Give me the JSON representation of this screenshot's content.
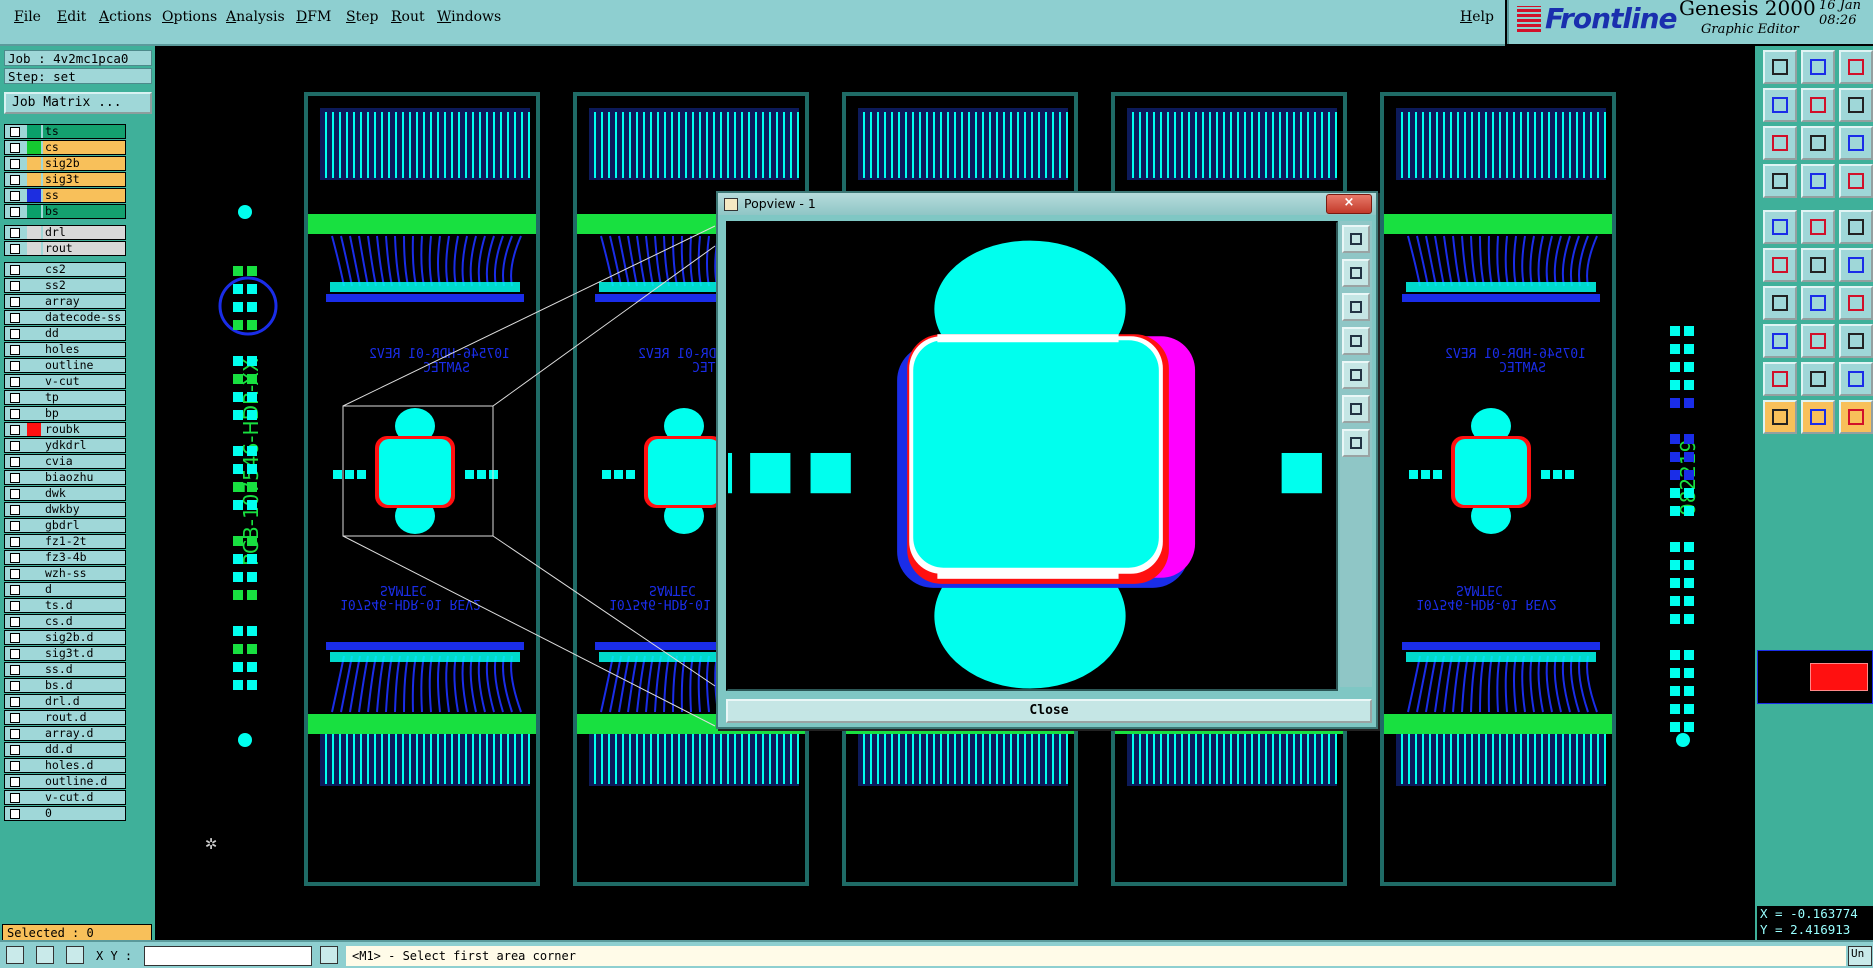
{
  "menu": {
    "items": [
      "File",
      "Edit",
      "Actions",
      "Options",
      "Analysis",
      "DFM",
      "Step",
      "Rout",
      "Windows"
    ],
    "help": "Help"
  },
  "brand": {
    "logo_text": "Frontline",
    "product": "Genesis 2000",
    "subtitle": "Graphic Editor",
    "date_line1": "16 Jan",
    "date_line2": "08:26"
  },
  "job": {
    "job_label": "Job : 4v2mc1pca0",
    "step_label": "Step: set",
    "matrix_button": "Job Matrix ..."
  },
  "layers": {
    "group1": [
      {
        "name": "ts",
        "swatch": "#0aa06a",
        "bg": "#14a16f"
      },
      {
        "name": "cs",
        "swatch": "#15c930",
        "bg": "#f8c05a"
      },
      {
        "name": "sig2b",
        "swatch": "#f8c05a",
        "bg": "#f8c05a"
      },
      {
        "name": "sig3t",
        "swatch": "#f8c05a",
        "bg": "#f8c05a"
      },
      {
        "name": "ss",
        "swatch": "#1d2ee0",
        "bg": "#f8c05a"
      },
      {
        "name": "bs",
        "swatch": "#0aa06a",
        "bg": "#14a16f"
      }
    ],
    "group2": [
      {
        "name": "drl",
        "swatch": "#d8d8d8",
        "bg": "#d8d8d8"
      },
      {
        "name": "rout",
        "swatch": "#d8d8d8",
        "bg": "#d8d8d8"
      }
    ],
    "group3": [
      "cs2",
      "ss2",
      "array",
      "datecode-ss",
      "dd",
      "holes",
      "outline",
      "v-cut",
      "tp",
      "bp",
      "roubk",
      "ydkdrl",
      "cvia",
      "biaozhu",
      "dwk",
      "dwkby",
      "gbdrl",
      "fz1-2t",
      "fz3-4b",
      "wzh-ss",
      "d",
      "ts.d",
      "cs.d",
      "sig2b.d",
      "sig3t.d",
      "ss.d",
      "bs.d",
      "drl.d",
      "rout.d",
      "array.d",
      "dd.d",
      "holes.d",
      "outline.d",
      "v-cut.d",
      "0"
    ]
  },
  "selected": "Selected : 0",
  "board": {
    "labels_top": [
      "10Ʌ2 10-ЯDH-8Ԁ2Ɩ01",
      "10Ʌ2 10-ЯDH-8Ԁ2Ɩ01",
      "10Ʌ2 10-ЯDH-8Ԁ2Ɩ01"
    ],
    "samtec": "SAMTEC",
    "rev_label": "107546-HDR-01   REV2",
    "side_text": "PCB-107546-HDR-XX",
    "date_code": "082219"
  },
  "popview": {
    "title": "Popview - 1",
    "close_label": "Close",
    "close_x": "×"
  },
  "coords": {
    "x": "X = -0.163774",
    "y": "Y = 2.416913"
  },
  "status": {
    "xy_label": "X Y :",
    "prompt": "<M1> - Select first area corner",
    "right_btn": "Un"
  },
  "colors": {
    "cyan": "#00ffee",
    "green": "#18e040",
    "blue": "#1a2de8",
    "red": "#ff1010",
    "magenta": "#ff00ff",
    "panel_teal": "#3fb09a",
    "menu_bg": "#8ecfd0"
  }
}
